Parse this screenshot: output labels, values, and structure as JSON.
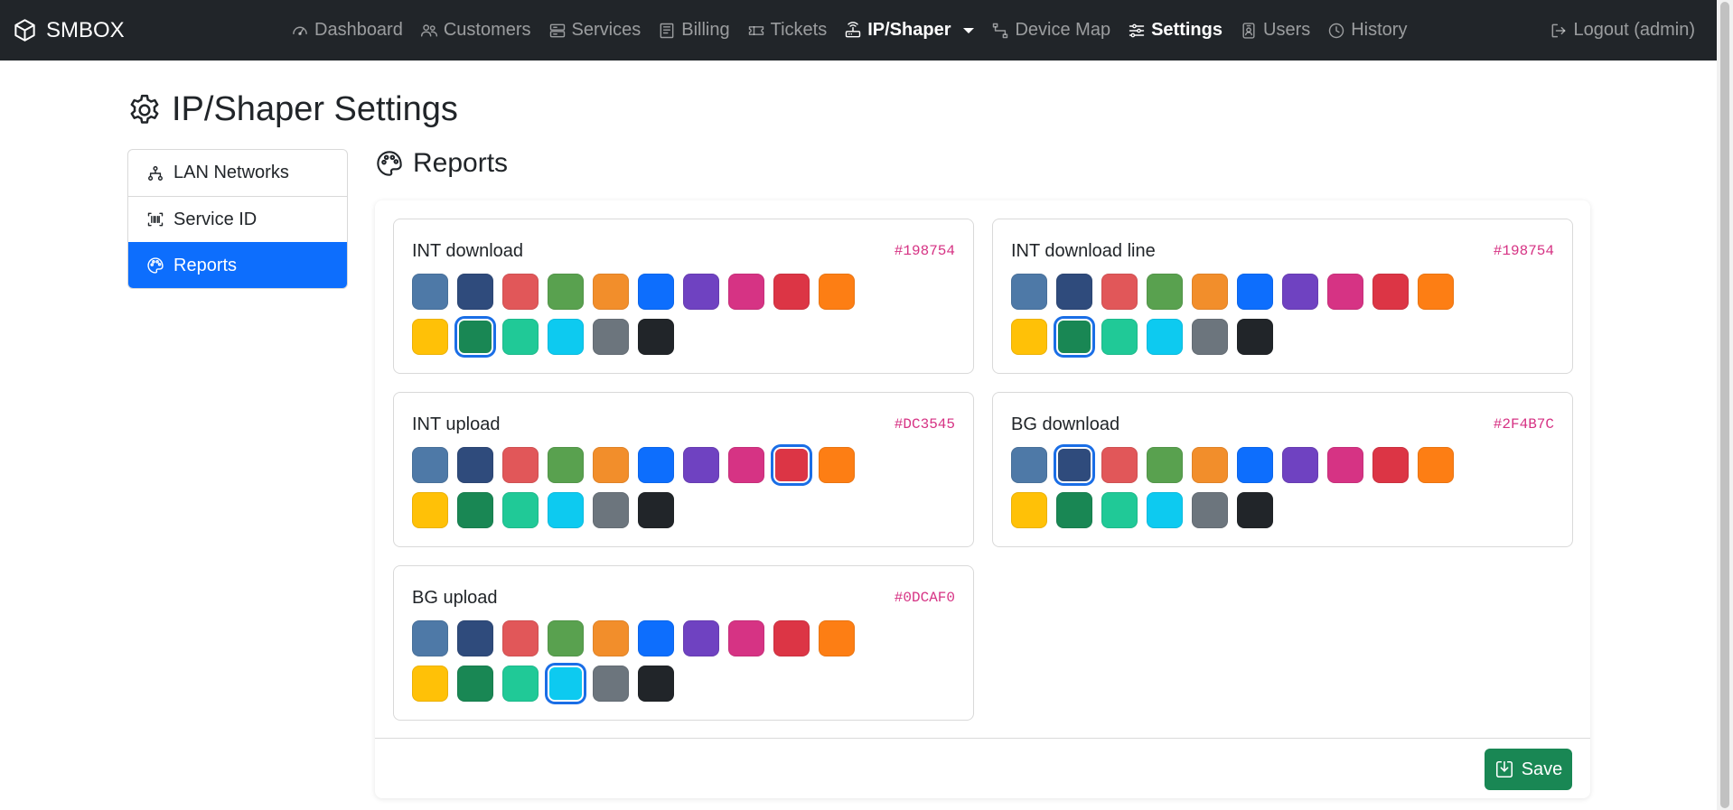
{
  "brand": {
    "name": "SMBOX"
  },
  "nav": [
    {
      "label": "Dashboard",
      "icon": "speedometer-icon",
      "active": false
    },
    {
      "label": "Customers",
      "icon": "people-icon",
      "active": false
    },
    {
      "label": "Services",
      "icon": "server-icon",
      "active": false
    },
    {
      "label": "Billing",
      "icon": "receipt-icon",
      "active": false
    },
    {
      "label": "Tickets",
      "icon": "ticket-icon",
      "active": false
    },
    {
      "label": "IP/Shaper",
      "icon": "router-icon",
      "active": true,
      "dropdown": true
    },
    {
      "label": "Device Map",
      "icon": "diagram-icon",
      "active": false
    },
    {
      "label": "Settings",
      "icon": "sliders-icon",
      "active": true
    },
    {
      "label": "Users",
      "icon": "person-badge-icon",
      "active": false
    },
    {
      "label": "History",
      "icon": "clock-icon",
      "active": false
    }
  ],
  "logout": {
    "label": "Logout (admin)"
  },
  "page": {
    "title": "IP/Shaper Settings"
  },
  "side_menu": [
    {
      "label": "LAN Networks",
      "icon": "network-icon",
      "active": false
    },
    {
      "label": "Service ID",
      "icon": "barcode-icon",
      "active": false
    },
    {
      "label": "Reports",
      "icon": "palette-icon",
      "active": true
    }
  ],
  "section": {
    "title": "Reports"
  },
  "palette": [
    "#4E79A7",
    "#2F4B7C",
    "#E15759",
    "#59A14F",
    "#F28E2B",
    "#0D6EFD",
    "#6F42C1",
    "#D63384",
    "#DC3545",
    "#FD7E14",
    "#FFC107",
    "#198754",
    "#20C997",
    "#0DCAF0",
    "#6C757D",
    "#212529"
  ],
  "color_settings": [
    {
      "label": "INT download",
      "value": "#198754"
    },
    {
      "label": "INT download line",
      "value": "#198754"
    },
    {
      "label": "INT upload",
      "value": "#DC3545"
    },
    {
      "label": "BG download",
      "value": "#2F4B7C"
    },
    {
      "label": "BG upload",
      "value": "#0DCAF0"
    }
  ],
  "footer": {
    "save_label": "Save"
  }
}
